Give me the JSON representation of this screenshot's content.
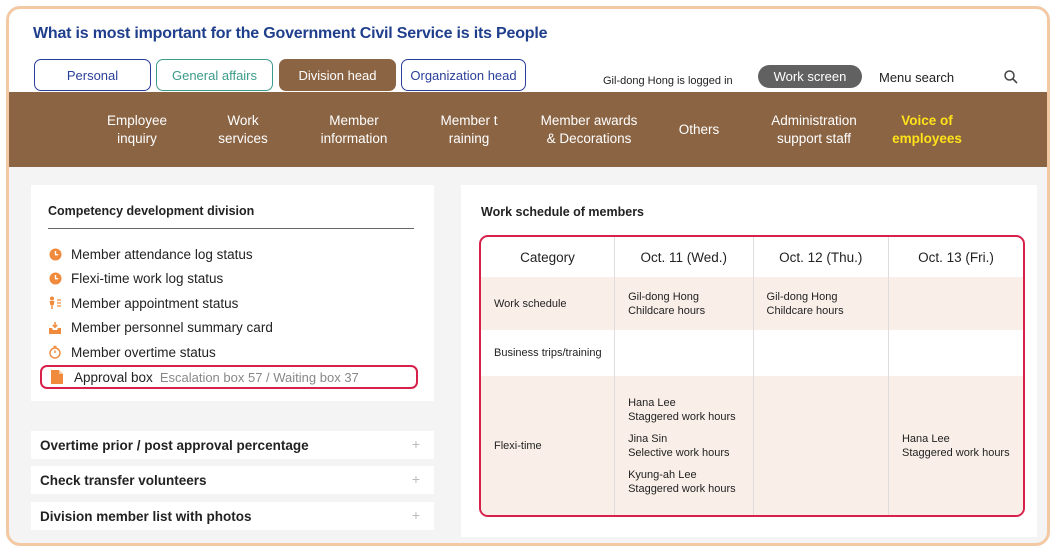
{
  "header": {
    "title": "What is most important  for the Government Civil Service is its People",
    "roles": [
      "Personal",
      "General affairs",
      "Division head",
      "Organization head"
    ],
    "login_text": "Gil-dong Hong is logged in",
    "work_screen": "Work screen",
    "menu_search": "Menu search"
  },
  "gnb": {
    "items": [
      [
        "Employee",
        "inquiry"
      ],
      [
        "Work",
        "services"
      ],
      [
        "Member",
        "information"
      ],
      [
        "Member t",
        "raining"
      ],
      [
        "Member awards",
        "& Decorations"
      ],
      [
        "Others"
      ],
      [
        "Administration",
        "support staff"
      ],
      [
        "Voice of",
        "employees"
      ]
    ]
  },
  "left_panel": {
    "title": "Competency development division",
    "links": [
      "Member attendance log status",
      "Flexi-time work log status",
      "Member appointment status",
      "Member personnel summary card",
      "Member overtime status"
    ],
    "approval_label": "Approval box",
    "approval_sub": "Escalation box 57 / Waiting box 37"
  },
  "accordions": [
    "Overtime prior / post approval percentage",
    "Check transfer volunteers",
    "Division member list with photos"
  ],
  "schedule": {
    "title": "Work schedule of members",
    "headers": [
      "Category",
      "Oct. 11 (Wed.)",
      "Oct. 12 (Thu.)",
      "Oct. 13 (Fri.)"
    ],
    "rows": {
      "work_schedule": "Work schedule",
      "business_trips": "Business trips/training",
      "flexi_time": "Flexi-time"
    },
    "cells": {
      "ws_oct11_name": "Gil-dong Hong",
      "ws_oct11_type": "Childcare hours",
      "ws_oct12_name": "Gil-dong Hong",
      "ws_oct12_type": "Childcare hours",
      "ft_oct11": [
        [
          "Hana Lee",
          "Staggered work hours"
        ],
        [
          "Jina Sin",
          "Selective work hours"
        ],
        [
          "Kyung-ah Lee",
          "Staggered work hours"
        ]
      ],
      "ft_oct13": [
        "Hana Lee",
        "Staggered work hours"
      ]
    }
  },
  "colors": {
    "accent_brown": "#8b6443",
    "title_blue": "#1f3f8c",
    "highlight_red": "#d7214b",
    "icon_orange": "#f08a3c",
    "voice_yellow": "#ffe21a"
  }
}
